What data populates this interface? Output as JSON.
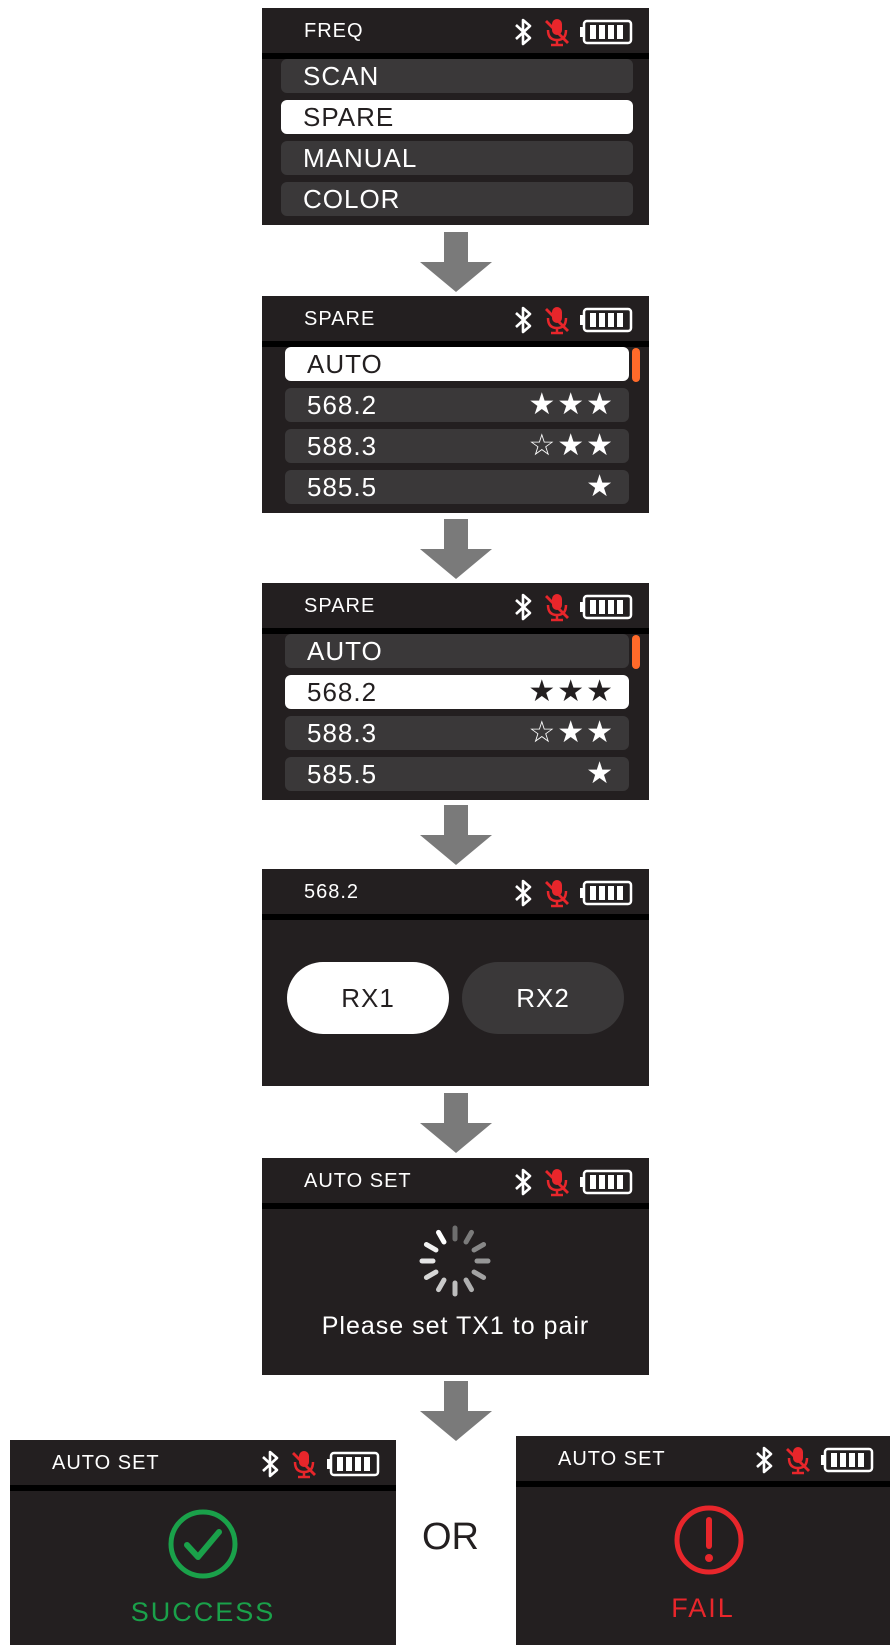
{
  "colors": {
    "screen_bg": "#231f20",
    "row_bg": "#3a3839",
    "selected_bg": "#ffffff",
    "mic_red": "#e8262b",
    "scroll_accent": "#ff6a2a",
    "success_green": "#1aa14a",
    "fail_red": "#e8262b",
    "arrow_gray": "#7a7a7a"
  },
  "screen1": {
    "title": "FREQ",
    "items": [
      "SCAN",
      "SPARE",
      "MANUAL",
      "COLOR"
    ],
    "selected": "SPARE"
  },
  "screen2": {
    "title": "SPARE",
    "items": [
      {
        "label": "AUTO",
        "stars": ""
      },
      {
        "label": "568.2",
        "stars": "★★★"
      },
      {
        "label": "588.3",
        "stars": "☆★★"
      },
      {
        "label": "585.5",
        "stars": "★"
      }
    ],
    "selected": "AUTO"
  },
  "screen3": {
    "title": "SPARE",
    "items": [
      {
        "label": "AUTO",
        "stars": ""
      },
      {
        "label": "568.2",
        "stars": "★★★"
      },
      {
        "label": "588.3",
        "stars": "☆★★"
      },
      {
        "label": "585.5",
        "stars": "★"
      }
    ],
    "selected": "568.2"
  },
  "screen4": {
    "title": "568.2",
    "buttons": [
      "RX1",
      "RX2"
    ],
    "selected": "RX1"
  },
  "screen5": {
    "title": "AUTO SET",
    "message": "Please set TX1 to pair",
    "icon": "loading-spinner-icon"
  },
  "or_label": "OR",
  "screen6": {
    "title": "AUTO SET",
    "status": "SUCCESS",
    "icon": "check-circle-icon"
  },
  "screen7": {
    "title": "AUTO SET",
    "status": "FAIL",
    "icon": "exclamation-circle-icon"
  },
  "status_icons": [
    "bluetooth-icon",
    "mic-muted-icon",
    "battery-full-icon"
  ]
}
